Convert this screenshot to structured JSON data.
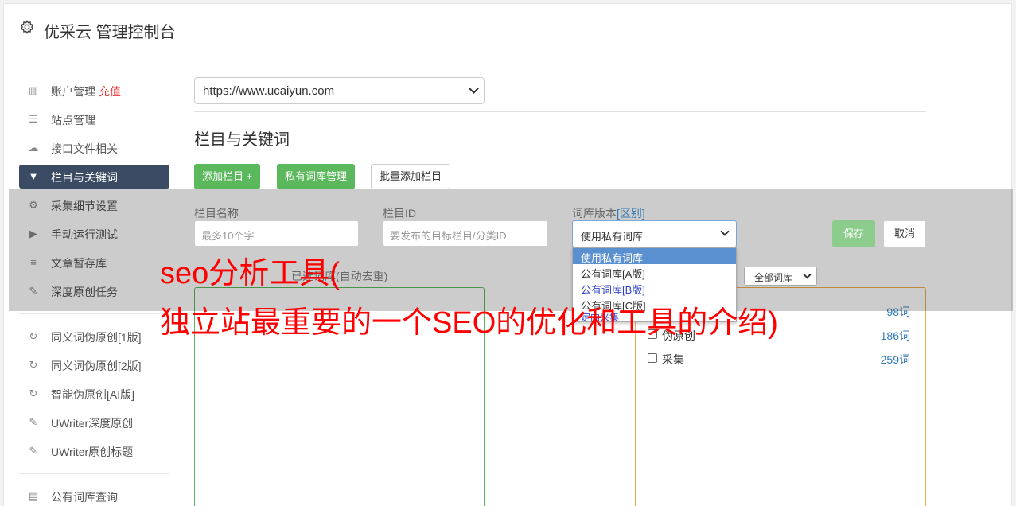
{
  "header": {
    "title": "优采云 管理控制台"
  },
  "sidebar": {
    "items": [
      {
        "label": "账户管理",
        "extra": "充值",
        "icon": "bar-chart-icon"
      },
      {
        "label": "站点管理",
        "icon": "server-icon"
      },
      {
        "label": "接口文件相关",
        "icon": "cloud-upload-icon"
      },
      {
        "label": "栏目与关键词",
        "icon": "filter-icon"
      },
      {
        "label": "采集细节设置",
        "icon": "gears-icon"
      },
      {
        "label": "手动运行测试",
        "icon": "play-circle-icon"
      },
      {
        "label": "文章暂存库",
        "icon": "database-icon"
      },
      {
        "label": "深度原创任务",
        "icon": "edit-icon"
      },
      {
        "label": "同义词伪原创[1版]",
        "icon": "refresh-icon"
      },
      {
        "label": "同义词伪原创[2版]",
        "icon": "refresh-icon"
      },
      {
        "label": "智能伪原创[AI版]",
        "icon": "refresh-icon"
      },
      {
        "label": "UWriter深度原创",
        "icon": "edit-icon"
      },
      {
        "label": "UWriter原创标题",
        "icon": "edit-icon"
      },
      {
        "label": "公有词库查询",
        "icon": "book-icon"
      }
    ]
  },
  "main": {
    "site_select": "https://www.ucaiyun.com",
    "section_title": "栏目与关键词",
    "buttons": {
      "add_column": "添加栏目 +",
      "private_lib": "私有词库管理",
      "batch_add": "批量添加栏目"
    },
    "form": {
      "name_label": "栏目名称",
      "name_placeholder": "最多10个字",
      "id_label": "栏目ID",
      "id_placeholder": "要发布的目标栏目/分类ID",
      "version_label": "词库版本",
      "version_link": "[区别]",
      "version_value": "使用私有词库",
      "version_options": [
        "使用私有词库",
        "公有词库[A版]",
        "公有词库[B版]",
        "公有词库[C版]",
        "定向采集"
      ],
      "save": "保存",
      "cancel": "取消"
    },
    "selected_label": "已选词库(自动去重)",
    "lib_filter": "全部词库",
    "libraries": [
      {
        "name": "",
        "count": "98词"
      },
      {
        "name": "伪原创",
        "count": "186词"
      },
      {
        "name": "采集",
        "count": "259词"
      }
    ]
  },
  "overlay_text": {
    "line1": "seo分析工具(",
    "line2": "独立站最重要的一个SEO的优化和工具的介绍)"
  }
}
